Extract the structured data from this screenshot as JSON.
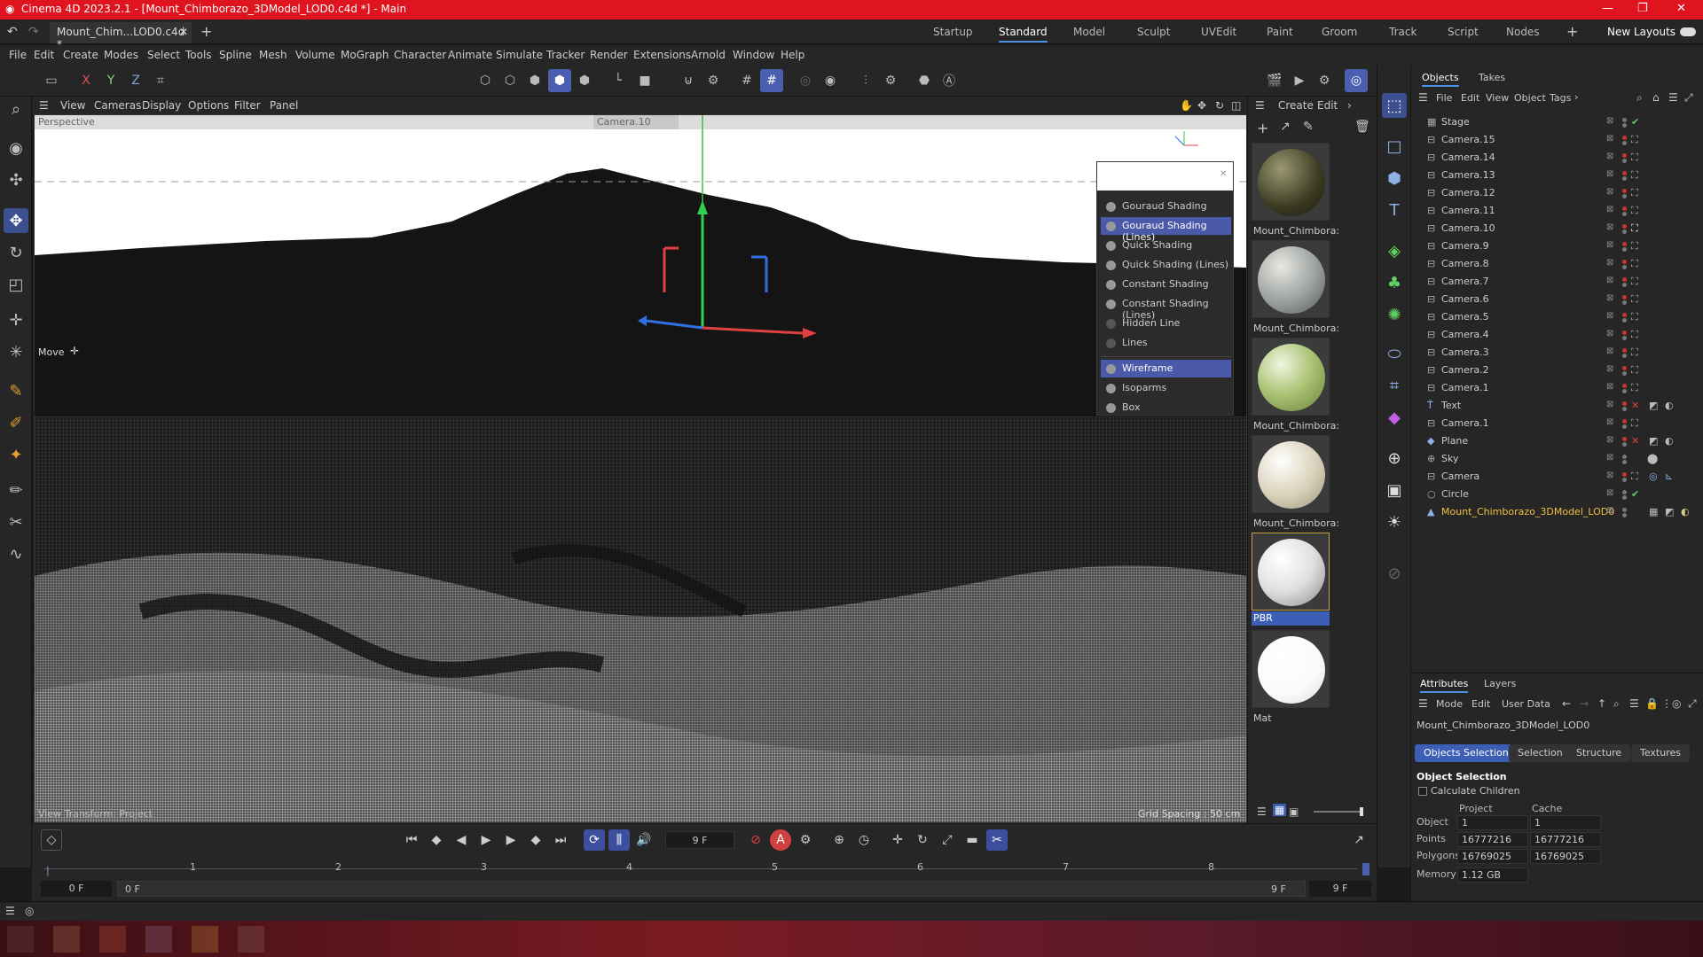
{
  "titlebar": {
    "title": "Cinema 4D 2023.2.1 - [Mount_Chimborazo_3DModel_LOD0.c4d *] - Main"
  },
  "tabbar": {
    "doc_tab": "Mount_Chim...LOD0.c4d *",
    "layouts": [
      "Startup",
      "Standard",
      "Model",
      "Sculpt",
      "UVEdit",
      "Paint",
      "Groom",
      "Track",
      "Script",
      "Nodes"
    ],
    "new_layouts": "New Layouts"
  },
  "menubar": [
    "File",
    "Edit",
    "Create",
    "Modes",
    "Select",
    "Tools",
    "Spline",
    "Mesh",
    "Volume",
    "MoGraph",
    "Character",
    "Animate",
    "Simulate",
    "Tracker",
    "Render",
    "Extensions",
    "Arnold",
    "Window",
    "Help"
  ],
  "viewport": {
    "menus": [
      "View",
      "Cameras",
      "Display",
      "Options",
      "Filter",
      "Panel"
    ],
    "label": "Perspective",
    "camera": "Camera.10",
    "move_label": "Move",
    "info": "View Transform: Project",
    "grid": "Grid Spacing : 50 cm"
  },
  "shading_menu": [
    {
      "label": "Gouraud Shading",
      "sel": false
    },
    {
      "label": "Gouraud Shading (Lines)",
      "sel": true
    },
    {
      "label": "Quick Shading",
      "sel": false
    },
    {
      "label": "Quick Shading (Lines)",
      "sel": false
    },
    {
      "label": "Constant Shading",
      "sel": false
    },
    {
      "label": "Constant Shading (Lines)",
      "sel": false
    },
    {
      "label": "Hidden Line",
      "sel": false
    },
    {
      "label": "Lines",
      "sel": false
    },
    {
      "label": "Wireframe",
      "sel": true
    },
    {
      "label": "Isoparms",
      "sel": false
    },
    {
      "label": "Box",
      "sel": false
    }
  ],
  "materials": {
    "menus": [
      "Create",
      "Edit"
    ],
    "items": [
      {
        "label": "Mount_Chimbora:",
        "color": "#4a4a2a"
      },
      {
        "label": "Mount_Chimbora:",
        "color": "#9aa0a0"
      },
      {
        "label": "Mount_Chimbora:",
        "color": "#a8c070"
      },
      {
        "label": "Mount_Chimbora:",
        "color": "#d8d0b8"
      },
      {
        "label": "PBR",
        "color": "#e8e8e8"
      },
      {
        "label": "Mat",
        "color": "#ffffff"
      }
    ]
  },
  "objects": {
    "tabs": [
      "Objects",
      "Takes"
    ],
    "menus": [
      "File",
      "Edit",
      "View",
      "Object",
      "Tags"
    ],
    "rows": [
      "Stage",
      "Camera.15",
      "Camera.14",
      "Camera.13",
      "Camera.12",
      "Camera.11",
      "Camera.10",
      "Camera.9",
      "Camera.8",
      "Camera.7",
      "Camera.6",
      "Camera.5",
      "Camera.4",
      "Camera.3",
      "Camera.2",
      "Camera.1",
      "Text",
      "Camera.1",
      "Plane",
      "Sky",
      "Camera",
      "Circle",
      "Mount_Chimborazo_3DModel_LOD0"
    ]
  },
  "attributes": {
    "tabs": [
      "Attributes",
      "Layers"
    ],
    "menus": [
      "Mode",
      "Edit",
      "User Data"
    ],
    "object_name": "Mount_Chimborazo_3DModel_LOD0",
    "subtabs": [
      "Objects Selection",
      "Selection",
      "Structure",
      "Textures"
    ],
    "section": "Object Selection",
    "calc_children": "Calculate Children",
    "col_project": "Project",
    "col_cache": "Cache",
    "rows": [
      {
        "label": "Object",
        "project": "1",
        "cache": "1"
      },
      {
        "label": "Points",
        "project": "16777216",
        "cache": "16777216"
      },
      {
        "label": "Polygons",
        "project": "16769025",
        "cache": "16769025"
      },
      {
        "label": "Memory",
        "project": "1.12 GB",
        "cache": ""
      }
    ]
  },
  "timeline": {
    "frame": "9 F",
    "start": "0 F",
    "range_start": "0 F",
    "range_end": "9 F",
    "end": "9 F",
    "ticks": [
      "0",
      "1",
      "2",
      "3",
      "4",
      "5",
      "6",
      "7",
      "8"
    ]
  },
  "accent": "#4a5fb0",
  "title_color": "#e0141e"
}
